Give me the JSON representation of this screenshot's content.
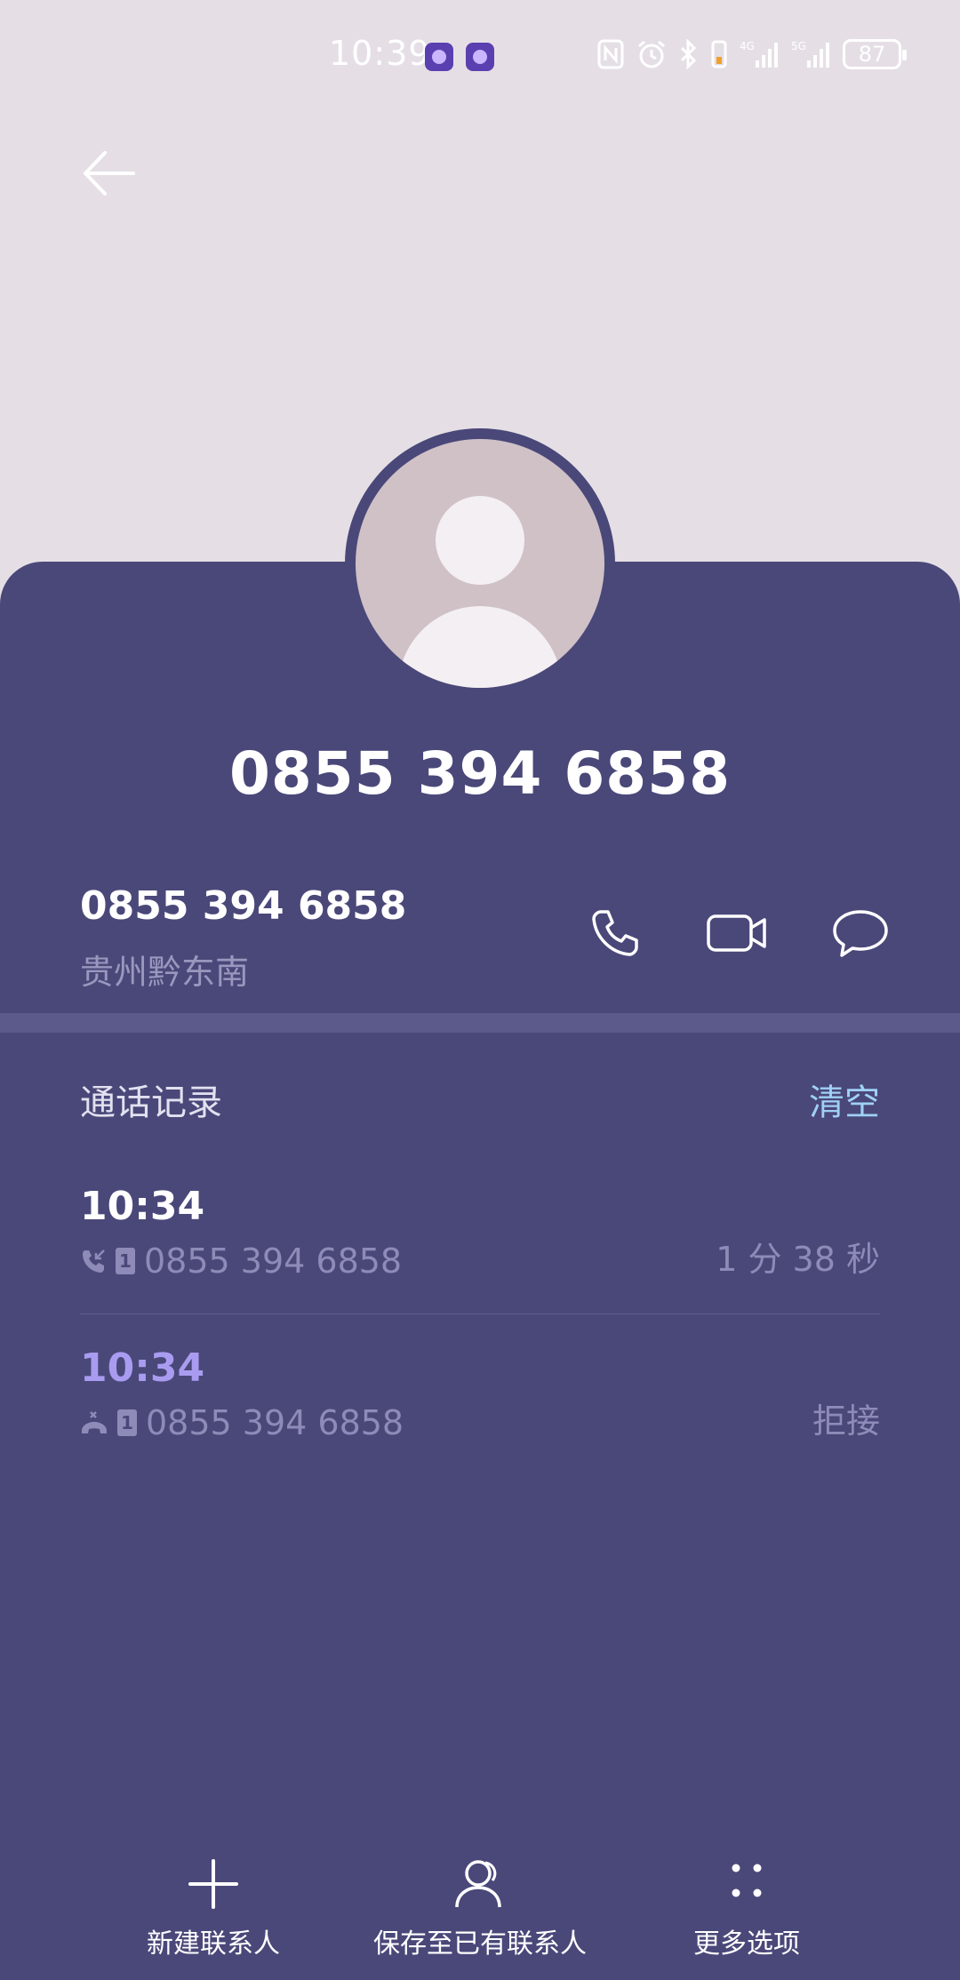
{
  "status_bar": {
    "time": "10:39",
    "battery": "87",
    "icons": [
      "nfc-icon",
      "alarm-icon",
      "bluetooth-icon",
      "vibrate-icon",
      "signal-4g-icon",
      "signal-5g-icon"
    ]
  },
  "contact": {
    "display_number": "0855 394 6858",
    "number": "0855 394 6858",
    "location": "贵州黔东南"
  },
  "actions": [
    "phone-icon",
    "video-call-icon",
    "message-icon"
  ],
  "call_log": {
    "title": "通话记录",
    "clear_label": "清空",
    "entries": [
      {
        "time": "10:34",
        "type": "incoming",
        "number": "0855 394 6858",
        "info": "1 分 38 秒"
      },
      {
        "time": "10:34",
        "type": "rejected",
        "number": "0855 394 6858",
        "info": "拒接"
      }
    ]
  },
  "bottom_bar": {
    "new_contact": "新建联系人",
    "save_existing": "保存至已有联系人",
    "more_options": "更多选项"
  },
  "colors": {
    "top_background": "#e5dfe5",
    "card_background": "#4a4879",
    "accent_clear": "#9fd0f5",
    "missed_time": "#a99cf0"
  }
}
